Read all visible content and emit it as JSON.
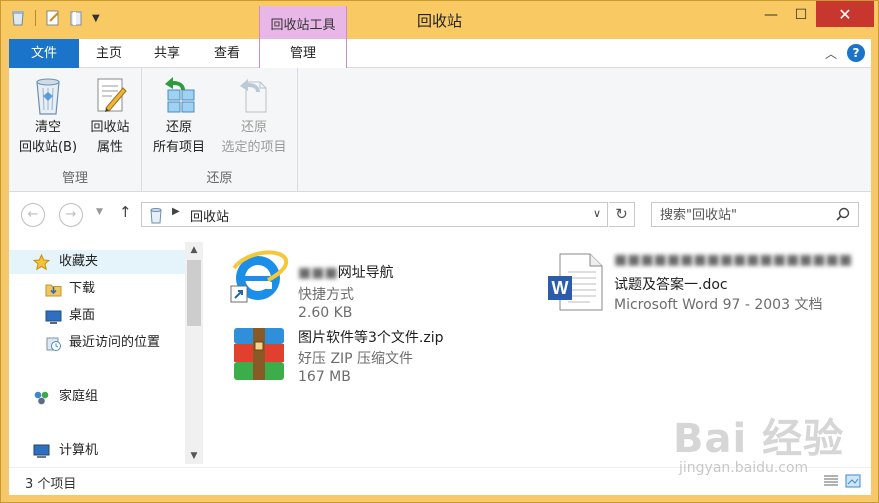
{
  "window": {
    "title": "回收站",
    "context_header": "回收站工具"
  },
  "ribbon_tabs": {
    "file": "文件",
    "home": "主页",
    "share": "共享",
    "view": "查看",
    "manage": "管理"
  },
  "ribbon": {
    "groups": [
      {
        "label": "管理",
        "buttons": [
          {
            "line1": "清空",
            "line2": "回收站(B)",
            "icon": "recycle-bin-icon"
          },
          {
            "line1": "回收站",
            "line2": "属性",
            "icon": "properties-icon"
          }
        ]
      },
      {
        "label": "还原",
        "buttons": [
          {
            "line1": "还原",
            "line2": "所有项目",
            "icon": "restore-all-icon"
          },
          {
            "line1": "还原",
            "line2": "选定的项目",
            "icon": "restore-selected-icon",
            "disabled": true
          }
        ]
      }
    ]
  },
  "address": {
    "path": "回收站",
    "search_placeholder": "搜索\"回收站\""
  },
  "nav_pane": {
    "items": [
      {
        "label": "收藏夹",
        "icon": "star-icon"
      },
      {
        "label": "下载",
        "icon": "download-folder-icon"
      },
      {
        "label": "桌面",
        "icon": "desktop-icon"
      },
      {
        "label": "最近访问的位置",
        "icon": "recent-places-icon"
      },
      {
        "label": "家庭组",
        "icon": "homegroup-icon"
      },
      {
        "label": "计算机",
        "icon": "computer-icon"
      }
    ]
  },
  "files": [
    {
      "name_visible": "网址导航",
      "name_hidden": "■■■",
      "type": "快捷方式",
      "size": "2.60 KB",
      "icon": "ie-shortcut-icon"
    },
    {
      "name_hidden": "■■■■■■■■■■■■■■■■■■",
      "name_visible": "试题及答案一.doc",
      "type": "Microsoft Word 97 - 2003 文档",
      "icon": "word-document-icon"
    },
    {
      "name": "图片软件等3个文件.zip",
      "type": "好压 ZIP 压缩文件",
      "size": "167 MB",
      "icon": "zip-archive-icon"
    }
  ],
  "status": {
    "count": "3 个项目"
  },
  "watermark": {
    "brand": "Bai 经验",
    "url": "jingyan.baidu.com"
  },
  "colors": {
    "title_bar": "#f9c963",
    "file_tab": "#1a74c9",
    "context_tab": "#e8b7e8",
    "close_button": "#c7372e"
  }
}
